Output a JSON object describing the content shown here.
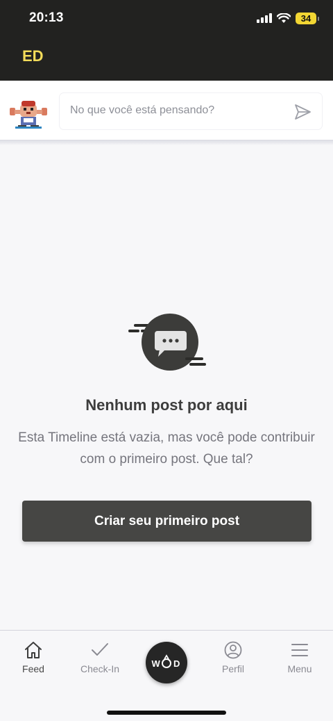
{
  "status_bar": {
    "time": "20:13",
    "battery": "34"
  },
  "header": {
    "title": "ED"
  },
  "composer": {
    "placeholder": "No que você está pensando?"
  },
  "empty_state": {
    "title": "Nenhum post por aqui",
    "description": "Esta Timeline está vazia, mas você pode contribuir com o primeiro post. Que tal?",
    "button_label": "Criar seu primeiro post"
  },
  "tab_bar": {
    "items": [
      {
        "label": "Feed",
        "icon": "home-icon",
        "active": true
      },
      {
        "label": "Check-In",
        "icon": "check-icon",
        "active": false
      },
      {
        "label": "",
        "icon": "wod-logo-icon",
        "active": false
      },
      {
        "label": "Perfil",
        "icon": "profile-icon",
        "active": false
      },
      {
        "label": "Menu",
        "icon": "hamburger-icon",
        "active": false
      }
    ]
  },
  "colors": {
    "header_bg": "#222220",
    "header_title": "#f3dc5a",
    "button_bg": "#464644",
    "battery": "#f2d633",
    "page_bg": "#f7f7f9"
  }
}
